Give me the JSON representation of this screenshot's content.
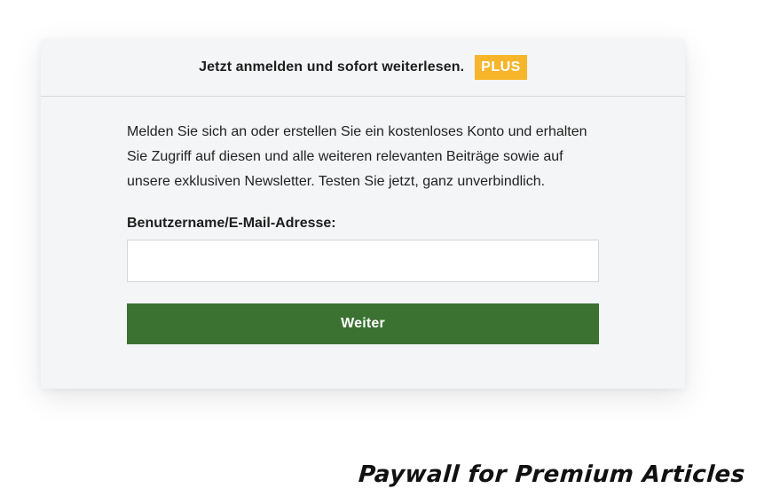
{
  "paywall": {
    "header_text": "Jetzt anmelden und sofort weiterlesen.",
    "badge_label": "PLUS",
    "intro_text": "Melden Sie sich an oder erstellen Sie ein kostenloses Konto und erhalten Sie Zugriff auf diesen und alle weiteren relevanten Beiträge sowie auf unsere exklusiven Newsletter. Testen Sie jetzt, ganz unverbindlich.",
    "field_label": "Benutzername/E-Mail-Adresse:",
    "field_value": "",
    "field_placeholder": "",
    "submit_label": "Weiter"
  },
  "caption": "Paywall for Premium Articles",
  "colors": {
    "badge": "#f7b52c",
    "button": "#3b7232",
    "card_background": "#f4f5f7"
  }
}
